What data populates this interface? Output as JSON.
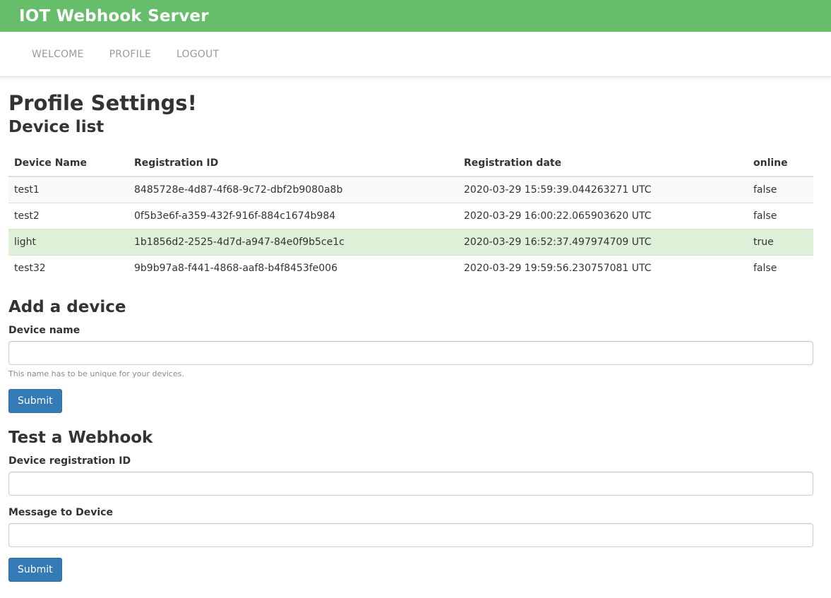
{
  "header": {
    "title": "IOT Webhook Server"
  },
  "nav": {
    "items": [
      {
        "label": "WELCOME"
      },
      {
        "label": "PROFILE"
      },
      {
        "label": "LOGOUT"
      }
    ]
  },
  "page": {
    "title": "Profile Settings!"
  },
  "device_list": {
    "heading": "Device list",
    "columns": [
      "Device Name",
      "Registration ID",
      "Registration date",
      "online"
    ],
    "rows": [
      {
        "name": "test1",
        "id": "8485728e-4d87-4f68-9c72-dbf2b9080a8b",
        "date": "2020-03-29 15:59:39.044263271 UTC",
        "online": "false"
      },
      {
        "name": "test2",
        "id": "0f5b3e6f-a359-432f-916f-884c1674b984",
        "date": "2020-03-29 16:00:22.065903620 UTC",
        "online": "false"
      },
      {
        "name": "light",
        "id": "1b1856d2-2525-4d7d-a947-84e0f9b5ce1c",
        "date": "2020-03-29 16:52:37.497974709 UTC",
        "online": "true"
      },
      {
        "name": "test32",
        "id": "9b9b97a8-f441-4868-aaf8-b4f8453fe006",
        "date": "2020-03-29 19:59:56.230757081 UTC",
        "online": "false"
      }
    ]
  },
  "add_device": {
    "heading": "Add a device",
    "label": "Device name",
    "value": "",
    "help": "This name has to be unique for your devices.",
    "submit": "Submit"
  },
  "test_webhook": {
    "heading": "Test a Webhook",
    "id_label": "Device registration ID",
    "id_value": "",
    "message_label": "Message to Device",
    "message_value": "",
    "submit": "Submit"
  },
  "colors": {
    "header_bg": "#66bd6a",
    "primary_button": "#337ab7",
    "success_row": "#dff0d8"
  }
}
